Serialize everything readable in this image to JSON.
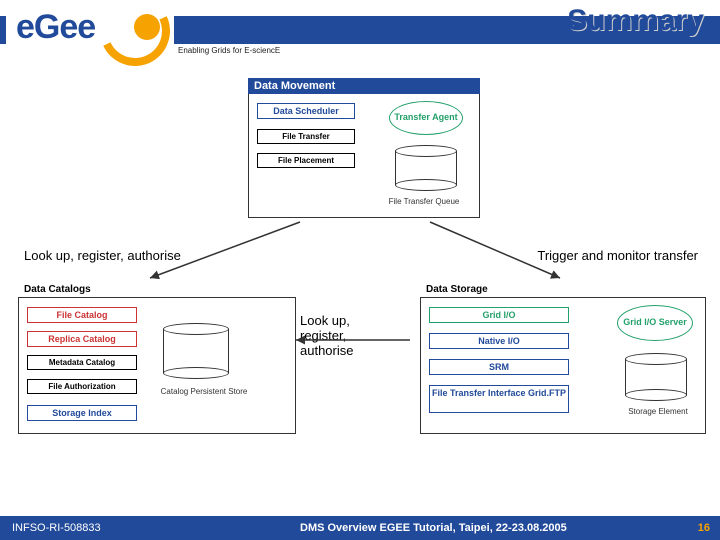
{
  "header": {
    "title": "Summary",
    "tagline": "Enabling Grids for E-sciencE",
    "logo_text": "eGee"
  },
  "captions": {
    "left": "Look up, register, authorise",
    "right": "Trigger and monitor transfer",
    "middle": "Look up, register, authorise"
  },
  "data_movement": {
    "title": "Data Movement",
    "items": [
      "Data Scheduler",
      "File Transfer",
      "File Placement"
    ],
    "agent": "Transfer Agent",
    "queue_label": "File Transfer Queue"
  },
  "data_catalogs": {
    "title": "Data Catalogs",
    "items": [
      "File Catalog",
      "Replica Catalog",
      "Metadata Catalog",
      "File Authorization",
      "Storage Index"
    ],
    "store_label": "Catalog Persistent Store"
  },
  "data_storage": {
    "title": "Data Storage",
    "items": [
      "Grid I/O",
      "Native I/O",
      "SRM",
      "File Transfer Interface Grid.FTP"
    ],
    "server": "Grid I/O Server",
    "element_label": "Storage Element"
  },
  "footer": {
    "left": "INFSO-RI-508833",
    "mid": "DMS Overview EGEE Tutorial, Taipei, 22-23.08.2005",
    "page": "16"
  }
}
